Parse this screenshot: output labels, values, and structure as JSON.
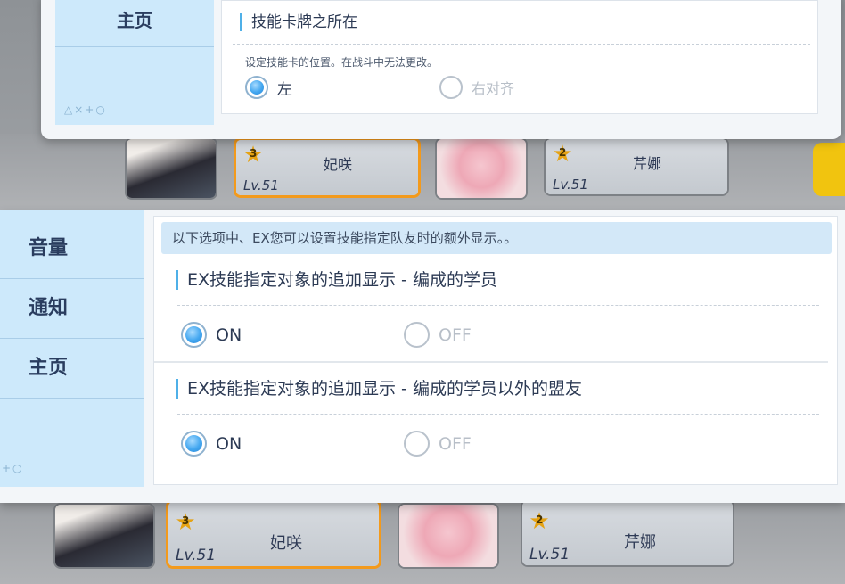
{
  "top_panel": {
    "nav_item": "主页",
    "nav_decor": "△×+○",
    "section_title": "技能卡牌之所在",
    "hint": "设定技能卡的位置。在战斗中无法更改。",
    "option_left": "左",
    "option_right": "右对齐"
  },
  "characters": [
    {
      "stars": "3",
      "level": "Lv.51",
      "name": "妃咲"
    },
    {
      "stars": "2",
      "level": "Lv.51",
      "name": "芹娜"
    }
  ],
  "bottom_panel": {
    "nav_items": [
      "音量",
      "通知",
      "主页"
    ],
    "nav_decor": "+○",
    "info": "以下选项中、EX您可以设置技能指定队友时的额外显示。。",
    "sections": [
      {
        "title": "EX技能指定对象的追加显示 - 编成的学员",
        "on": "ON",
        "off": "OFF",
        "selected": "ON"
      },
      {
        "title": "EX技能指定对象的追加显示 - 编成的学员以外的盟友",
        "on": "ON",
        "off": "OFF",
        "selected": "ON"
      }
    ]
  },
  "colors": {
    "accent": "#4fb0e8",
    "sidebar": "#cde9fb",
    "selected_border": "#f39a1c"
  }
}
